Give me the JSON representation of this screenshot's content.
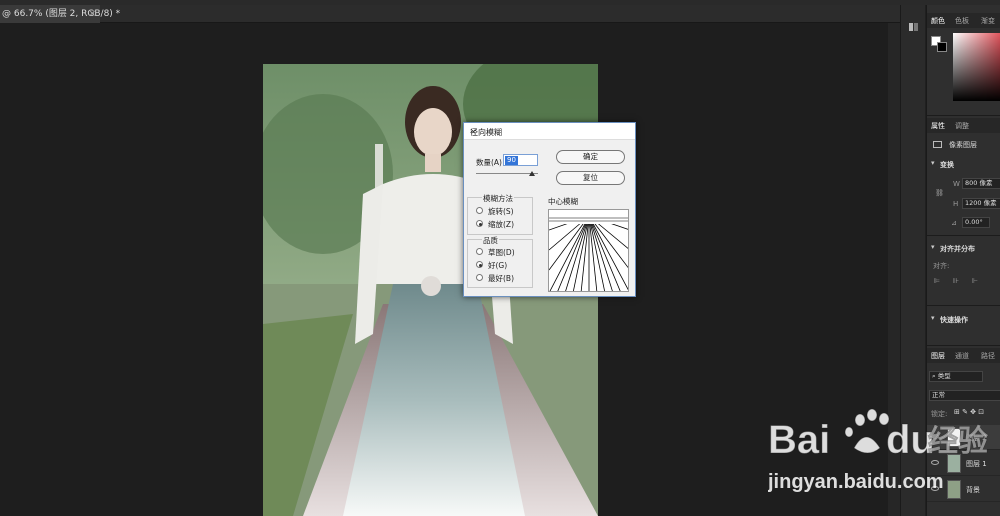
{
  "document_tab": {
    "label": "@ 66.7% (图层 2, RGB/8) *",
    "close": "×"
  },
  "dialog": {
    "title": "径向模糊",
    "close": "×",
    "amount_label": "数量(A)",
    "amount_value": "90",
    "ok_label": "确定",
    "reset_label": "复位",
    "blur_method": {
      "caption": "模糊方法",
      "options": [
        {
          "label": "旋转(S)",
          "selected": false
        },
        {
          "label": "缩放(Z)",
          "selected": true
        }
      ]
    },
    "quality": {
      "caption": "品质",
      "options": [
        {
          "label": "草图(D)",
          "selected": false
        },
        {
          "label": "好(G)",
          "selected": true
        },
        {
          "label": "最好(B)",
          "selected": false
        }
      ]
    },
    "center_label": "中心模糊"
  },
  "panels": {
    "color_tabs": [
      "颜色",
      "色板",
      "渐变"
    ],
    "properties_tabs": [
      "属性",
      "调整"
    ],
    "pixel_layer": "像素图层",
    "transform_title": "变换",
    "width_label": "W",
    "width_value": "800 像素",
    "height_label": "H",
    "height_value": "1200 像素",
    "angle_value": "0.00°",
    "align_title": "对齐并分布",
    "align_sub": "对齐:",
    "quick_actions": "快速操作",
    "layers_tabs": [
      "图层",
      "通道",
      "路径"
    ],
    "kind_filter": "类型",
    "blend_mode": "正常",
    "lock_label": "锁定:",
    "layers": [
      {
        "name": "图层 2",
        "selected": true
      },
      {
        "name": "图层 1",
        "selected": false
      },
      {
        "name": "背景",
        "selected": false
      }
    ]
  },
  "watermark": {
    "brand": "Bai",
    "brand2": "du",
    "cn": "经验",
    "url": "jingyan.baidu.com"
  },
  "colors": {
    "accent": "#3375d8",
    "panel_bg": "#2f2f2f",
    "canvas_bg": "#1e1e1e"
  }
}
